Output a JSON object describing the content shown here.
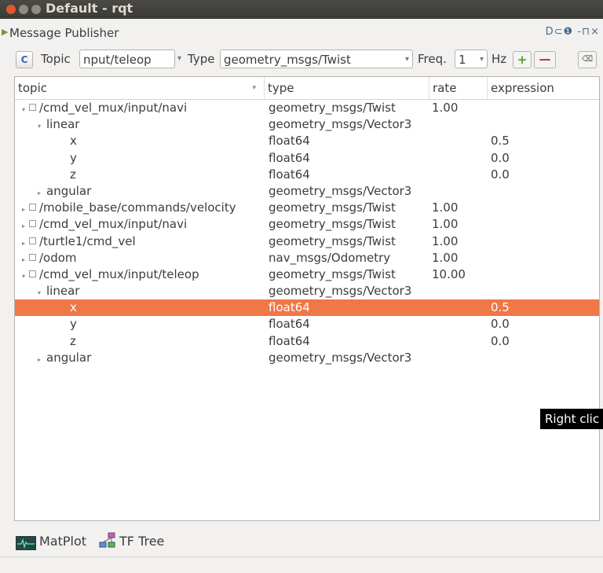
{
  "window": {
    "title": "Default - rqt"
  },
  "plugin": {
    "title": "Message Publisher",
    "controls": "D⊂❶ -⊓×"
  },
  "toolbar": {
    "topic_label": "Topic",
    "topic_value": "nput/teleop",
    "type_label": "Type",
    "type_value": "geometry_msgs/Twist",
    "freq_label": "Freq.",
    "freq_value": "1",
    "hz_label": "Hz",
    "plus_symbol": "+",
    "minus_symbol": "—",
    "clear_symbol": "⌫"
  },
  "tree": {
    "columns": [
      "topic",
      "type",
      "rate",
      "expression"
    ],
    "rows": [
      {
        "indent": 0,
        "arrow": "▾",
        "checkbox": true,
        "name": "/cmd_vel_mux/input/navi",
        "type": "geometry_msgs/Twist",
        "rate": "1.00",
        "expr": ""
      },
      {
        "indent": 1,
        "arrow": "▾",
        "checkbox": false,
        "name": "linear",
        "type": "geometry_msgs/Vector3",
        "rate": "",
        "expr": ""
      },
      {
        "indent": 2,
        "arrow": "",
        "checkbox": false,
        "name": "x",
        "type": "float64",
        "rate": "",
        "expr": "0.5"
      },
      {
        "indent": 2,
        "arrow": "",
        "checkbox": false,
        "name": "y",
        "type": "float64",
        "rate": "",
        "expr": "0.0"
      },
      {
        "indent": 2,
        "arrow": "",
        "checkbox": false,
        "name": "z",
        "type": "float64",
        "rate": "",
        "expr": "0.0"
      },
      {
        "indent": 1,
        "arrow": "▸",
        "checkbox": false,
        "name": "angular",
        "type": "geometry_msgs/Vector3",
        "rate": "",
        "expr": ""
      },
      {
        "indent": 0,
        "arrow": "▸",
        "checkbox": true,
        "name": "/mobile_base/commands/velocity",
        "type": "geometry_msgs/Twist",
        "rate": "1.00",
        "expr": ""
      },
      {
        "indent": 0,
        "arrow": "▸",
        "checkbox": true,
        "name": "/cmd_vel_mux/input/navi",
        "type": "geometry_msgs/Twist",
        "rate": "1.00",
        "expr": ""
      },
      {
        "indent": 0,
        "arrow": "▸",
        "checkbox": true,
        "name": "/turtle1/cmd_vel",
        "type": "geometry_msgs/Twist",
        "rate": "1.00",
        "expr": ""
      },
      {
        "indent": 0,
        "arrow": "▸",
        "checkbox": true,
        "name": "/odom",
        "type": "nav_msgs/Odometry",
        "rate": "1.00",
        "expr": ""
      },
      {
        "indent": 0,
        "arrow": "▾",
        "checkbox": true,
        "name": "/cmd_vel_mux/input/teleop",
        "type": "geometry_msgs/Twist",
        "rate": "10.00",
        "expr": ""
      },
      {
        "indent": 1,
        "arrow": "▾",
        "checkbox": false,
        "name": "linear",
        "type": "geometry_msgs/Vector3",
        "rate": "",
        "expr": ""
      },
      {
        "indent": 2,
        "arrow": "",
        "checkbox": false,
        "name": "x",
        "type": "float64",
        "rate": "",
        "expr": "0.5",
        "selected": true
      },
      {
        "indent": 2,
        "arrow": "",
        "checkbox": false,
        "name": "y",
        "type": "float64",
        "rate": "",
        "expr": "0.0"
      },
      {
        "indent": 2,
        "arrow": "",
        "checkbox": false,
        "name": "z",
        "type": "float64",
        "rate": "",
        "expr": "0.0"
      },
      {
        "indent": 1,
        "arrow": "▸",
        "checkbox": false,
        "name": "angular",
        "type": "geometry_msgs/Vector3",
        "rate": "",
        "expr": ""
      }
    ]
  },
  "tooltip": {
    "text": "Right clic"
  },
  "bottom": {
    "matplot_label": "MatPlot",
    "tftree_label": "TF Tree"
  },
  "colors": {
    "selection": "#f07746",
    "titlebar": "#3b3a36",
    "close_button": "#e0582e"
  }
}
